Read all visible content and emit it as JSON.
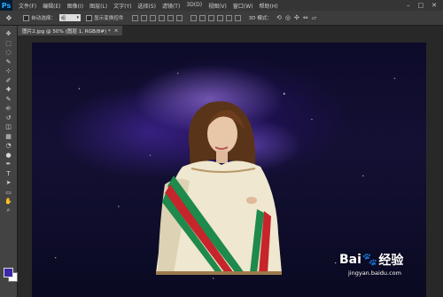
{
  "app": {
    "logo": "Ps"
  },
  "menu": {
    "items": [
      "文件(F)",
      "编辑(E)",
      "图像(I)",
      "图层(L)",
      "文字(Y)",
      "选择(S)",
      "滤镜(T)",
      "3D(D)",
      "视图(V)",
      "窗口(W)",
      "帮助(H)"
    ]
  },
  "window_controls": {
    "minimize": "–",
    "maximize": "□",
    "close": "✕"
  },
  "options_bar": {
    "auto_select_label": "自动选择：",
    "auto_select_value": "组",
    "show_transform_label": "显示变换控件",
    "mode_3d_label": "3D 模式："
  },
  "document_tab": {
    "title": "图片2.jpg @ 50% (图层 1, RGB/8#) *",
    "close": "×"
  },
  "tools": [
    "move-tool",
    "marquee-tool",
    "lasso-tool",
    "quick-select-tool",
    "crop-tool",
    "eyedropper-tool",
    "healing-tool",
    "brush-tool",
    "clone-stamp-tool",
    "history-brush-tool",
    "eraser-tool",
    "gradient-tool",
    "blur-tool",
    "dodge-tool",
    "pen-tool",
    "type-tool",
    "path-select-tool",
    "shape-tool",
    "hand-tool",
    "zoom-tool"
  ],
  "tool_glyphs": [
    "✥",
    "⬚",
    "◌",
    "✎",
    "⊹",
    "✐",
    "✚",
    "✎",
    "⎆",
    "↺",
    "◫",
    "▦",
    "◔",
    "●",
    "✒",
    "T",
    "➤",
    "▭",
    "✋",
    "⌕"
  ],
  "colors": {
    "foreground": "#3a2aa8",
    "background": "#ffffff",
    "accent_ps": "#31a8ff"
  },
  "watermark": {
    "brand_pre": "Bai",
    "brand_post": "经验",
    "url": "jingyan.baidu.com"
  }
}
